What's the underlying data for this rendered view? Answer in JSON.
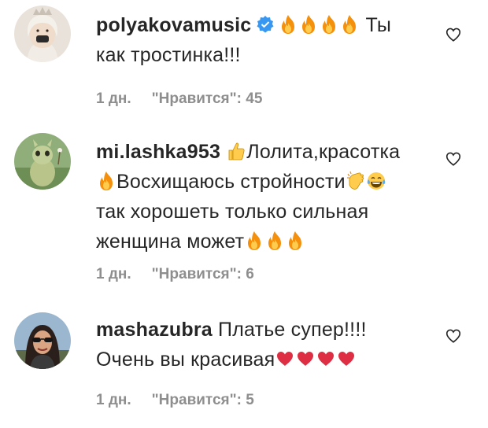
{
  "comments": [
    {
      "username": "polyakovamusic",
      "verified": true,
      "text_parts": [
        "Ты",
        "как тростинка!!!"
      ],
      "time": "1 дн.",
      "likes": "\"Нравится\": 45"
    },
    {
      "username": "mi.lashka953",
      "verified": false,
      "text_parts": [
        "Лолита,красотка",
        "Восхищаюсь стройности",
        "так хорошеть только сильная",
        "женщина может"
      ],
      "time": "1 дн.",
      "likes": "\"Нравится\": 6"
    },
    {
      "username": "mashazubra",
      "verified": false,
      "text_parts": [
        "Платье супер!!!!",
        "Очень вы красивая"
      ],
      "time": "1 дн.",
      "likes": "\"Нравится\": 5"
    }
  ],
  "icons": {
    "like": "heart-outline-icon",
    "verified": "verified-badge-icon",
    "fire": "fire-emoji",
    "thumbs_up": "thumbs-up-emoji",
    "clap": "clapping-hands-emoji",
    "laugh": "tears-of-joy-emoji",
    "heart": "red-heart-emoji"
  },
  "colors": {
    "text": "#262626",
    "meta": "#8e8e8e",
    "verified": "#3897f0",
    "fire": "#f4900c",
    "heart": "#dd2e44"
  }
}
